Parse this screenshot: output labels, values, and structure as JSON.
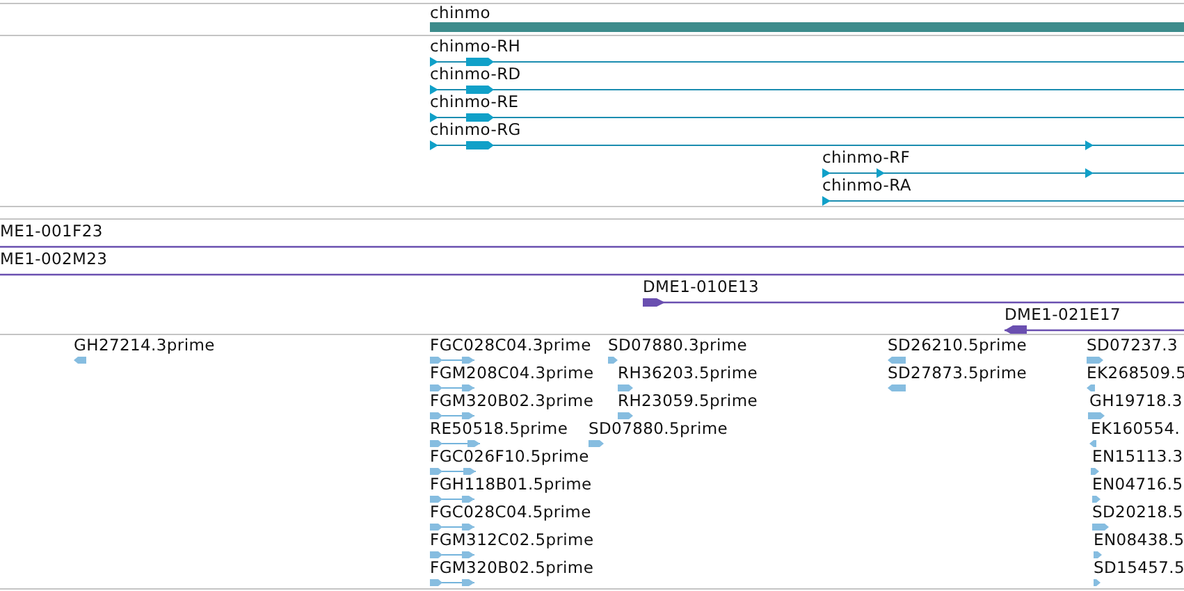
{
  "gene_track": {
    "features": [
      {
        "label": "chinmo"
      }
    ]
  },
  "transcript_track": {
    "features": [
      {
        "label": "chinmo-RH",
        "reverse": false
      },
      {
        "label": "chinmo-RD",
        "reverse": false
      },
      {
        "label": "chinmo-RE",
        "reverse": false
      },
      {
        "label": "chinmo-RG",
        "reverse": false
      },
      {
        "label": "chinmo-RF",
        "reverse": false
      },
      {
        "label": "chinmo-RA",
        "reverse": false
      }
    ]
  },
  "clone_track": {
    "features": [
      {
        "label": "ME1-001F23"
      },
      {
        "label": "ME1-002M23"
      },
      {
        "label": "DME1-010E13",
        "reverse": false
      },
      {
        "label": "DME1-021E17",
        "reverse": true
      }
    ]
  },
  "est_track": {
    "features": [
      {
        "label": "GH27214.3prime",
        "reverse": true
      },
      {
        "label": "FGC028C04.3prime",
        "reverse": false
      },
      {
        "label": "FGM208C04.3prime",
        "reverse": false
      },
      {
        "label": "FGM320B02.3prime",
        "reverse": false
      },
      {
        "label": "RE50518.5prime",
        "reverse": false
      },
      {
        "label": "FGC026F10.5prime",
        "reverse": false
      },
      {
        "label": "FGH118B01.5prime",
        "reverse": false
      },
      {
        "label": "FGC028C04.5prime",
        "reverse": false
      },
      {
        "label": "FGM312C02.5prime",
        "reverse": false
      },
      {
        "label": "FGM320B02.5prime",
        "reverse": false
      },
      {
        "label": "SD07880.3prime",
        "reverse": false
      },
      {
        "label": "RH36203.5prime",
        "reverse": false
      },
      {
        "label": "RH23059.5prime",
        "reverse": false
      },
      {
        "label": "SD07880.5prime",
        "reverse": false
      },
      {
        "label": "SD26210.5prime",
        "reverse": true
      },
      {
        "label": "SD27873.5prime",
        "reverse": true
      },
      {
        "label": "SD07237.3",
        "reverse": false
      },
      {
        "label": "EK268509.5",
        "reverse": true
      },
      {
        "label": "GH19718.3",
        "reverse": false
      },
      {
        "label": "EK160554.",
        "reverse": true
      },
      {
        "label": "EN15113.3",
        "reverse": false
      },
      {
        "label": "EN04716.5",
        "reverse": false
      },
      {
        "label": "SD20218.5",
        "reverse": false
      },
      {
        "label": "EN08438.5",
        "reverse": false
      },
      {
        "label": "SD15457.5",
        "reverse": false
      }
    ]
  }
}
